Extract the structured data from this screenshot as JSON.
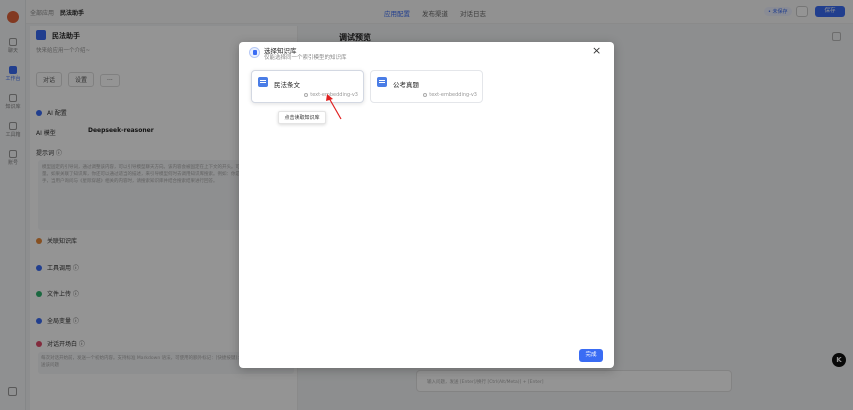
{
  "topbar": {
    "breadcrumb_root": "全部应用",
    "breadcrumb_current": "民法助手",
    "tabs": [
      "应用配置",
      "发布渠道",
      "对话日志"
    ],
    "status": "• 未保存",
    "publish_label": "保存"
  },
  "rail": {
    "items": [
      "聊天",
      "工作台",
      "知识库",
      "工具箱",
      "账号"
    ]
  },
  "app": {
    "name": "民法助手",
    "desc": "快来给应用一个介绍~",
    "chat_btn": "对话",
    "settings_btn": "设置",
    "more_btn": "···"
  },
  "config": {
    "ai_section": "AI 配置",
    "model_label": "AI 模型",
    "model_value": "Deepseek-reasoner",
    "prompt_label": "提示词 ⓘ",
    "prompt_text": "模型固定的引导词，通过调整该内容，可以引导模型聊天方向。该内容会被固定在上下文的开头。可通过输入 / 插入选择变量。如果关联了知识库，你还可以通过适当的描述，来引导模型何时去调用知识库搜索。例如：你是电影《星际穿越》的助手，当用户询问与《星际穿越》相关的内容时，请搜索知识库并结合搜索结果进行回答。",
    "kb_section": "关联知识库",
    "tools_section": "工具调用 ⓘ",
    "file_section": "文件上传 ⓘ",
    "voice_section": "全局变量 ⓘ",
    "opening_section": "对话开场白 ⓘ",
    "opening_text": "每次对话开始前，发送一个初始内容。支持标准 Markdown 语法，可使用的额外标记：[快捷按键]：用户点击后可以直接发送该问题"
  },
  "preview": {
    "title": "调试预览",
    "input_placeholder": "输入问题，发送 [Enter]/换行 [Ctrl(Alt/Meta)] + [Enter]"
  },
  "modal": {
    "title": "选择知识库",
    "subtitle": "仅能选择同一个索引模型的知识库",
    "cards": [
      {
        "name": "民法条文",
        "model": "text-embedding-v3"
      },
      {
        "name": "公考真题",
        "model": "text-embedding-v3"
      }
    ],
    "tooltip": "点击读取知识库",
    "done_label": "完成"
  },
  "badge": "K",
  "colors": {
    "accent": "#3a6cf4",
    "annotation_arrow": "#e02020"
  }
}
